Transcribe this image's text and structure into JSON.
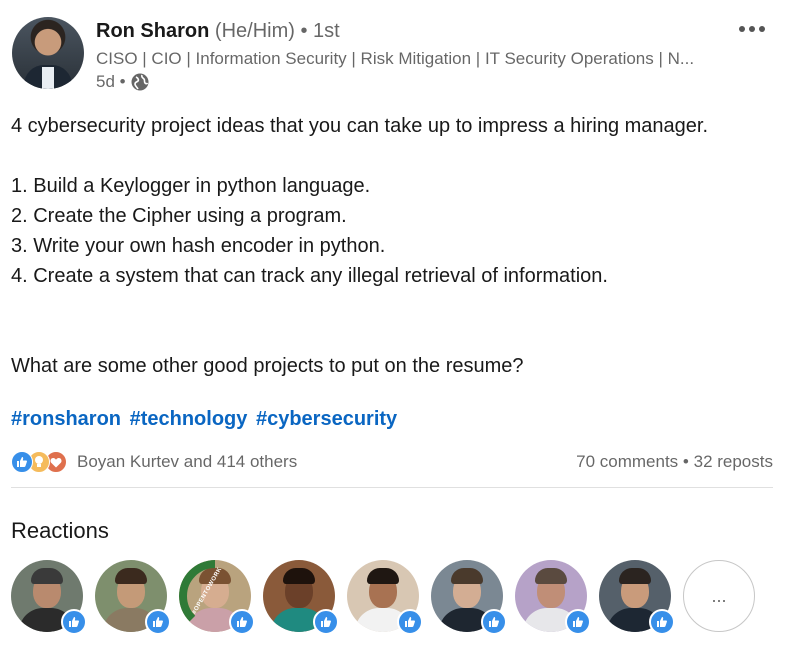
{
  "author": {
    "name": "Ron Sharon",
    "pronouns": "(He/Him)",
    "degree": "• 1st",
    "headline": "CISO | CIO | Information Security | Risk Mitigation | IT Security Operations | N...",
    "time": "5d •",
    "visibility_icon": "globe-icon",
    "more_icon": "more-options-icon"
  },
  "post": {
    "lines": [
      "4 cybersecurity project ideas that you can take up to impress a hiring manager.",
      "",
      "1. Build a Keylogger in python language.",
      "2. Create the Cipher using a program.",
      "3. Write your own hash encoder in python.",
      "4. Create a system that can track any illegal retrieval of information.",
      "",
      "",
      "What are some other good projects to put on the resume?"
    ],
    "hashtags": [
      "#ronsharon",
      "#technology",
      "#cybersecurity"
    ]
  },
  "social": {
    "reaction_types": [
      "like-icon",
      "insightful-icon",
      "love-icon"
    ],
    "reactors_summary": "Boyan Kurtev and 414 others",
    "comments": "70 comments",
    "separator": "•",
    "reposts": "32 reposts"
  },
  "reactions": {
    "title": "Reactions",
    "reactors": [
      {
        "name": "reactor-1",
        "bg": "#6f7a6e",
        "skin": "#b98a6e",
        "hair": "#3a3a3a",
        "shirt": "#2b2b2b",
        "badge": "like-icon"
      },
      {
        "name": "reactor-2",
        "bg": "#7e8f6d",
        "skin": "#c49a78",
        "hair": "#3b2a1e",
        "shirt": "#8a7a62",
        "badge": "like-icon"
      },
      {
        "name": "reactor-3",
        "bg": "#b9a37e",
        "skin": "#d6ad90",
        "hair": "#7a5232",
        "shirt": "#caa0a8",
        "badge": "like-icon",
        "open_to_work": "#OPENTOWORK"
      },
      {
        "name": "reactor-4",
        "bg": "#8a5a3a",
        "skin": "#6b4029",
        "hair": "#1e120c",
        "shirt": "#1f8a80",
        "badge": "like-icon"
      },
      {
        "name": "reactor-5",
        "bg": "#d8c7b3",
        "skin": "#a87252",
        "hair": "#1f1712",
        "shirt": "#f2f2f2",
        "badge": "like-icon"
      },
      {
        "name": "reactor-6",
        "bg": "#7b8893",
        "skin": "#d3ad93",
        "hair": "#4a3a2c",
        "shirt": "#1e2630",
        "badge": "like-icon"
      },
      {
        "name": "reactor-7",
        "bg": "#b6a2c8",
        "skin": "#c08e77",
        "hair": "#5a4a3f",
        "shirt": "#e7e7ea",
        "badge": "like-icon"
      },
      {
        "name": "reactor-8",
        "bg": "#55606a",
        "skin": "#c99b7b",
        "hair": "#2b2420",
        "shirt": "#1d2733",
        "badge": "like-icon"
      }
    ],
    "more_label": "..."
  },
  "colors": {
    "link": "#0a66c2",
    "like": "#378fe9",
    "insightful": "#f5bb5c",
    "love": "#df704d"
  }
}
